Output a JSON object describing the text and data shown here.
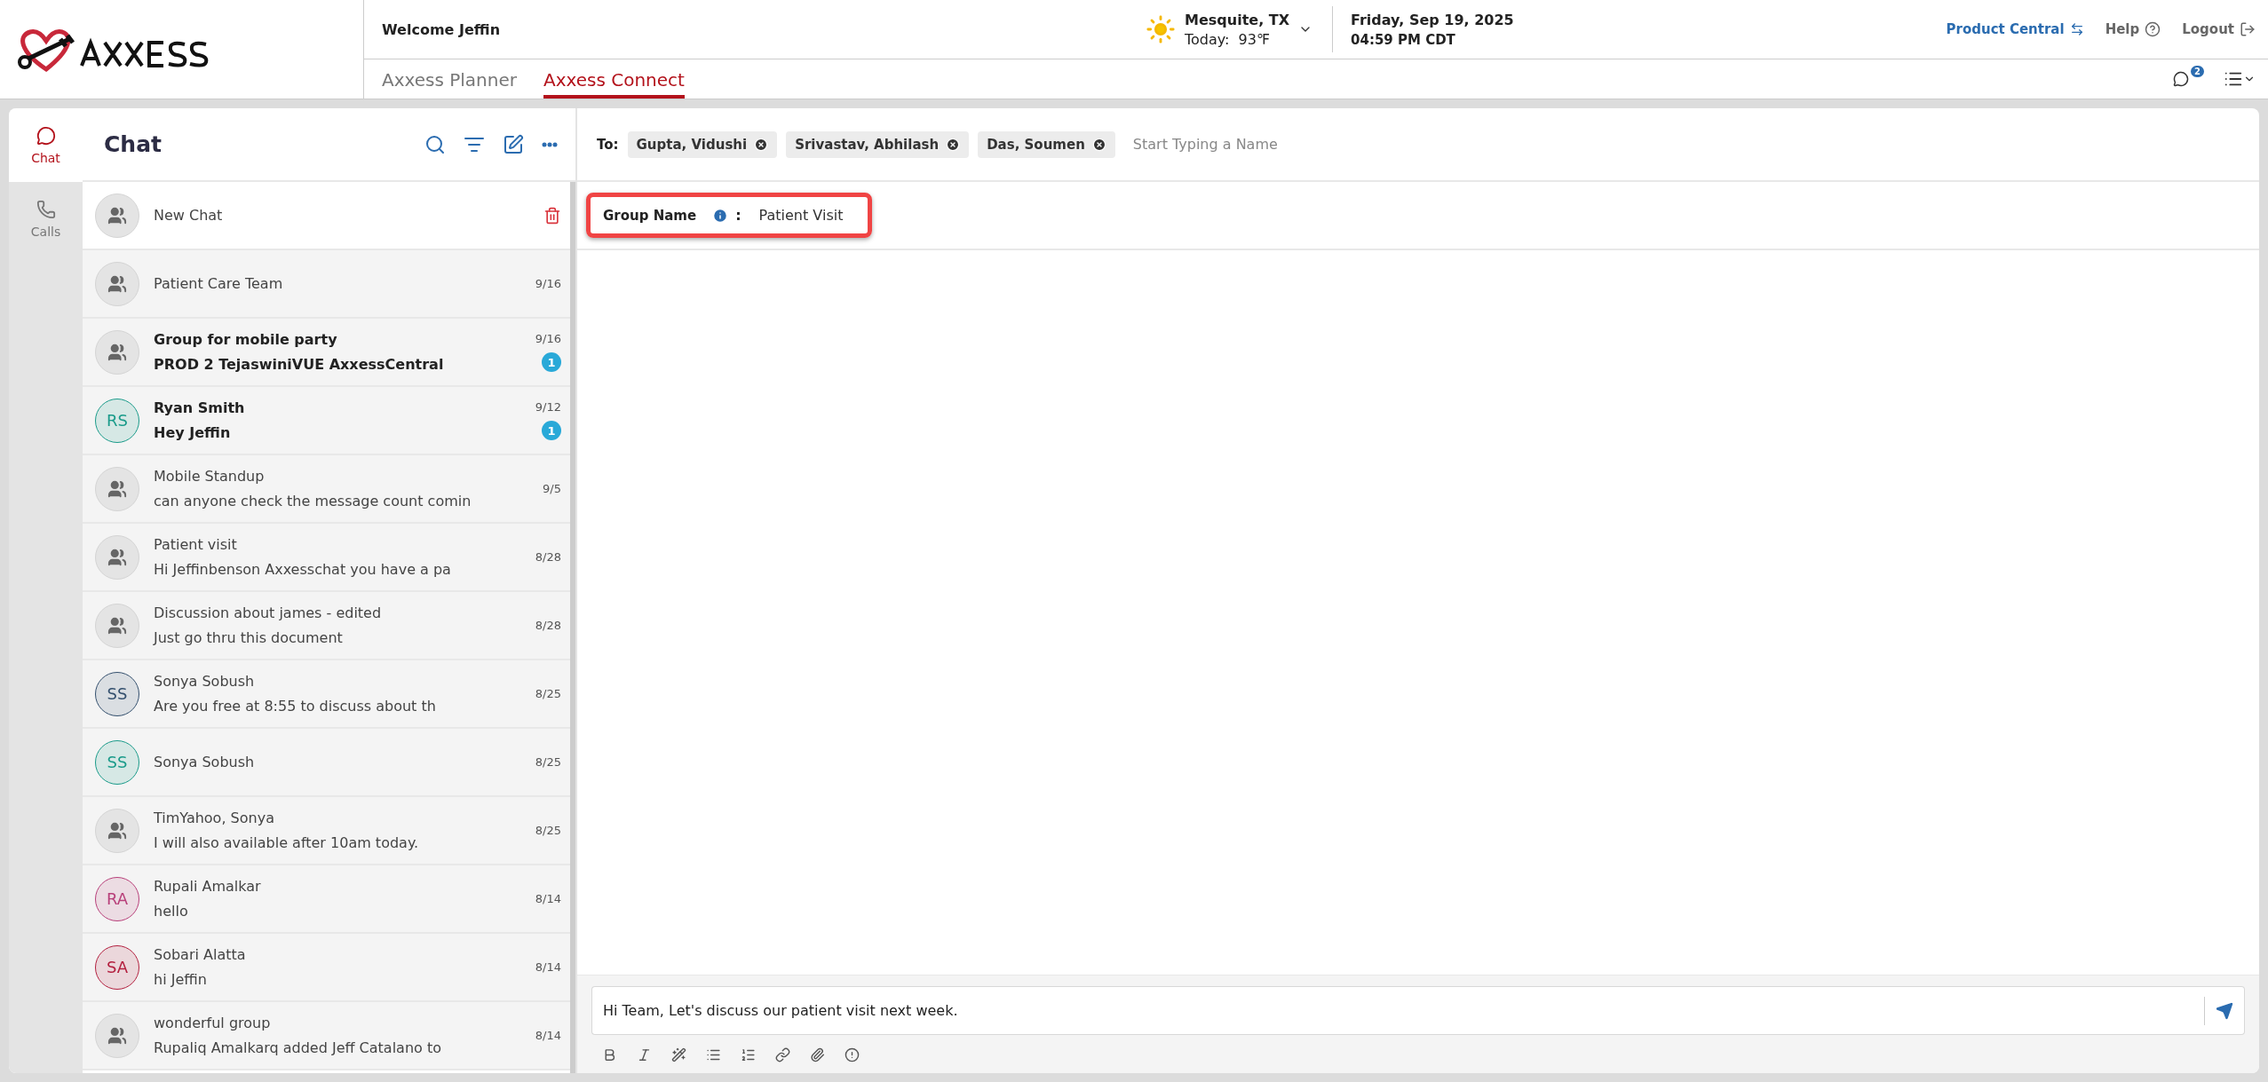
{
  "header": {
    "welcome": "Welcome Jeffin",
    "weather": {
      "location": "Mesquite, TX",
      "today_label": "Today:",
      "temperature": "93℉"
    },
    "date": "Friday, Sep 19, 2025",
    "time": "04:59 PM CDT",
    "links": [
      {
        "kind": "product",
        "label": "Product Central"
      },
      {
        "kind": "help",
        "label": "Help"
      },
      {
        "kind": "logout",
        "label": "Logout"
      }
    ]
  },
  "app_tabs": [
    {
      "label": "Axxess Planner",
      "selected": false
    },
    {
      "label": "Axxess Connect",
      "selected": true
    }
  ],
  "notification_badge": "2",
  "rail": [
    {
      "kind": "chat",
      "label": "Chat",
      "selected": true
    },
    {
      "kind": "calls",
      "label": "Calls",
      "selected": false
    }
  ],
  "chat_list": {
    "title": "Chat",
    "conversations": [
      {
        "kind": "new",
        "name": "New Chat"
      },
      {
        "kind": "group",
        "name": "Patient Care Team",
        "date": "9/16"
      },
      {
        "kind": "group",
        "name": "Group for mobile party",
        "preview": "PROD 2 TejaswiniVUE AxxessCentral",
        "date": "9/16",
        "unread": "1"
      },
      {
        "kind": "person",
        "initials": "RS",
        "color": "#1a9b8a",
        "name": "Ryan Smith",
        "preview": "Hey Jeffin",
        "date": "9/12",
        "unread": "1"
      },
      {
        "kind": "group",
        "name": "Mobile Standup",
        "preview": "can anyone check the message count comin",
        "date": "9/5"
      },
      {
        "kind": "group",
        "name": "Patient visit",
        "preview": "Hi Jeffinbenson Axxesschat you have a pa",
        "date": "8/28"
      },
      {
        "kind": "group",
        "name": "Discussion about james - edited",
        "preview": "Just go thru this document",
        "date": "8/28"
      },
      {
        "kind": "person",
        "initials": "SS",
        "color": "#34506e",
        "name": "Sonya Sobush",
        "preview": "Are you free at 8:55 to discuss about th",
        "date": "8/25"
      },
      {
        "kind": "person",
        "initials": "SS",
        "color": "#1a9b8a",
        "name": "Sonya Sobush",
        "date": "8/25"
      },
      {
        "kind": "group",
        "name": "TimYahoo, Sonya",
        "preview": "I will also available after 10am today.",
        "date": "8/25"
      },
      {
        "kind": "person",
        "initials": "RA",
        "color": "#b8407a",
        "name": "Rupali Amalkar",
        "preview": "hello",
        "date": "8/14"
      },
      {
        "kind": "person",
        "initials": "SA",
        "color": "#b3203f",
        "name": "Sobari Alatta",
        "preview": "hi Jeffin",
        "date": "8/14"
      },
      {
        "kind": "group",
        "name": "wonderful group",
        "preview": "Rupaliq Amalkarq added Jeff Catalano to",
        "date": "8/14"
      }
    ]
  },
  "compose": {
    "to_label": "To:",
    "recipients": [
      "Gupta, Vidushi",
      "Srivastav, Abhilash",
      "Das, Soumen"
    ],
    "recipient_placeholder": "Start Typing a Name",
    "group_name_label": "Group Name",
    "group_name_separator": ":",
    "group_name": "Patient Visit",
    "group_name_highlighted": true,
    "message": "Hi Team, Let's discuss our patient visit next week."
  }
}
